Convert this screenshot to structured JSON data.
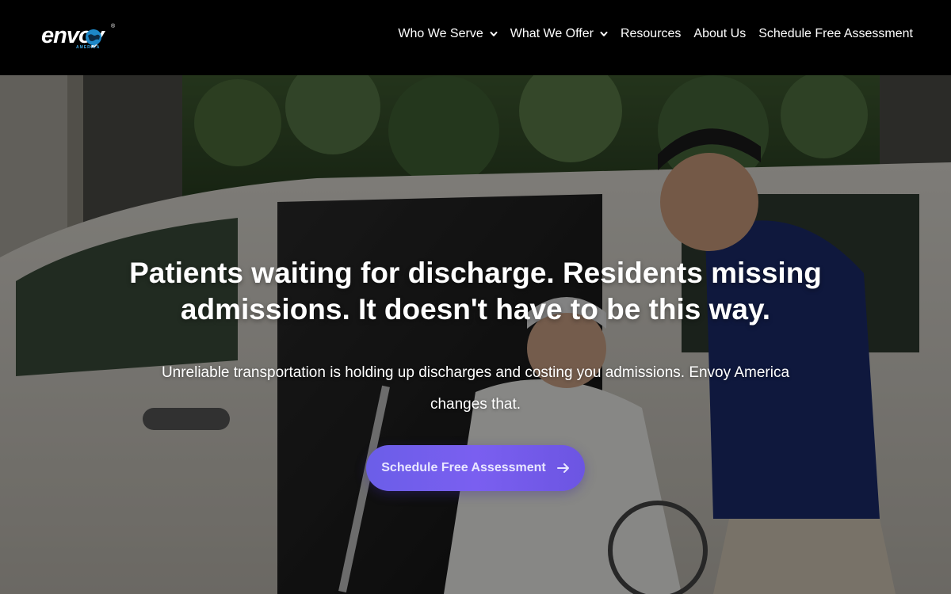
{
  "brand": {
    "name": "envoy",
    "subtitle": "AMERICA",
    "trademark": "®",
    "globe_color": "#1e88c8"
  },
  "nav": {
    "items": [
      {
        "label": "Who We Serve",
        "has_dropdown": true
      },
      {
        "label": "What We Offer",
        "has_dropdown": true
      },
      {
        "label": "Resources",
        "has_dropdown": false
      },
      {
        "label": "About Us",
        "has_dropdown": false
      },
      {
        "label": "Schedule Free Assessment",
        "has_dropdown": false
      }
    ]
  },
  "hero": {
    "title_line1": "Patients waiting for discharge. Residents missing",
    "title_line2": "admissions. It doesn't have to be this way.",
    "subtitle_line1": "Unreliable transportation is holding up discharges and costing you admissions. Envoy America",
    "subtitle_line2": "changes that.",
    "cta_label": "Schedule Free Assessment",
    "cta_icon": "arrow-right-icon",
    "accent_color": "#6b5ee8"
  }
}
